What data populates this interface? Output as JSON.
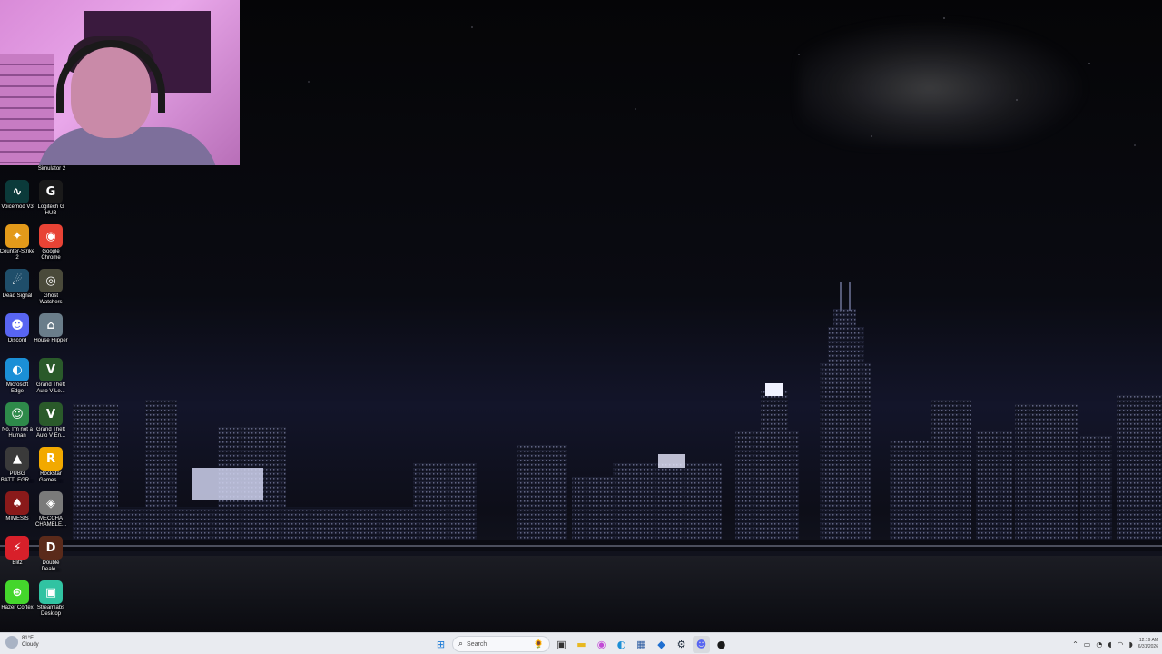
{
  "desktop": {
    "top_partial_label": "Simulator 2",
    "icons": [
      {
        "label": "Voicemod V3",
        "icon": "voicemod-icon",
        "color": "#0b3a3a"
      },
      {
        "label": "Logitech G HUB",
        "icon": "logitech-icon",
        "color": "#1a1a1a"
      },
      {
        "label": "Counter-Strike 2",
        "icon": "cs2-icon",
        "color": "#e39a1a"
      },
      {
        "label": "Google Chrome",
        "icon": "chrome-icon",
        "color": "#e84335"
      },
      {
        "label": "Dead Signal",
        "icon": "dead-signal-icon",
        "color": "#1f4e6a"
      },
      {
        "label": "Ghost Watchers",
        "icon": "ghost-watchers-icon",
        "color": "#4a4a3a"
      },
      {
        "label": "Discord",
        "icon": "discord-icon",
        "color": "#5865f2"
      },
      {
        "label": "House Flipper",
        "icon": "house-flipper-icon",
        "color": "#6a7d8a"
      },
      {
        "label": "Microsoft Edge",
        "icon": "edge-icon",
        "color": "#1b8fd6"
      },
      {
        "label": "Grand Theft Auto V Le...",
        "icon": "gta-v-icon",
        "color": "#2a5a2a"
      },
      {
        "label": "No, I'm not a Human",
        "icon": "no-im-not-a-human-icon",
        "color": "#2e8a4a"
      },
      {
        "label": "Grand Theft Auto V En...",
        "icon": "gta-v-enhanced-icon",
        "color": "#2a5a2a"
      },
      {
        "label": "PUBG BATTLEGR...",
        "icon": "pubg-icon",
        "color": "#3a3a3a"
      },
      {
        "label": "Rockstar Games ...",
        "icon": "rockstar-icon",
        "color": "#f2a900"
      },
      {
        "label": "MIMESIS",
        "icon": "mimesis-icon",
        "color": "#8a1a1a"
      },
      {
        "label": "MECCHA CHAMELE...",
        "icon": "meccha-chameleon-icon",
        "color": "#7a7a7a"
      },
      {
        "label": "Blitz",
        "icon": "blitz-icon",
        "color": "#d8202a"
      },
      {
        "label": "Double Deale...",
        "icon": "double-dealer-icon",
        "color": "#5a2a1a"
      },
      {
        "label": "Razer Cortex",
        "icon": "razer-cortex-icon",
        "color": "#44d62c"
      },
      {
        "label": "Streamlabs Desktop",
        "icon": "streamlabs-icon",
        "color": "#31c3a2"
      }
    ]
  },
  "taskbar": {
    "weather_temp": "81°F",
    "weather_desc": "Cloudy",
    "search_placeholder": "Search",
    "apps": [
      {
        "name": "start",
        "glyph": "⊞",
        "color": "#1a7ad6"
      },
      {
        "name": "task-view",
        "glyph": "▣",
        "color": "#333333"
      },
      {
        "name": "file-explorer",
        "glyph": "▬",
        "color": "#e8b820"
      },
      {
        "name": "copilot",
        "glyph": "◉",
        "color": "#c24ad6"
      },
      {
        "name": "edge",
        "glyph": "◐",
        "color": "#1b8fd6"
      },
      {
        "name": "calculator",
        "glyph": "▦",
        "color": "#2a5aa0"
      },
      {
        "name": "app-blue",
        "glyph": "◆",
        "color": "#1f6fd0"
      },
      {
        "name": "steam",
        "glyph": "⚙",
        "color": "#1b2838"
      },
      {
        "name": "discord",
        "glyph": "☻",
        "color": "#5865f2"
      },
      {
        "name": "obs",
        "glyph": "●",
        "color": "#1a1a1a"
      }
    ],
    "clock_time": "12:19 AM",
    "clock_date": "6/31/2026"
  }
}
